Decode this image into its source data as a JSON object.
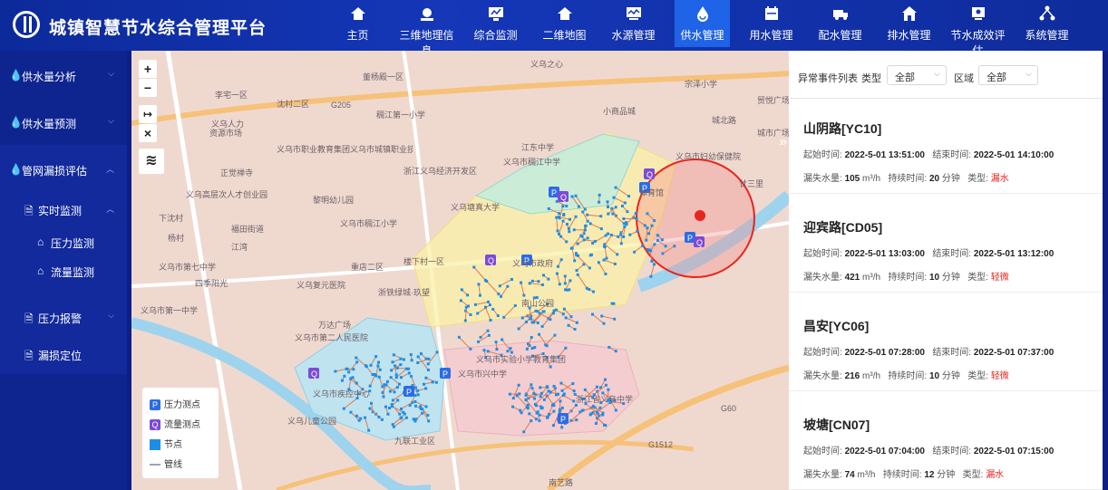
{
  "app": {
    "title": "城镇智慧节水综合管理平台"
  },
  "nav": [
    {
      "label": "主页",
      "icon": "home-icon"
    },
    {
      "label": "三维地理信息",
      "icon": "globe-icon"
    },
    {
      "label": "综合监测",
      "icon": "monitor-icon"
    },
    {
      "label": "二维地图",
      "icon": "home-icon"
    },
    {
      "label": "水源管理",
      "icon": "screen-chart-icon"
    },
    {
      "label": "供水管理",
      "icon": "water-drop-icon",
      "active": true
    },
    {
      "label": "用水管理",
      "icon": "calendar-icon"
    },
    {
      "label": "配水管理",
      "icon": "truck-icon"
    },
    {
      "label": "排水管理",
      "icon": "house-icon"
    },
    {
      "label": "节水成效评估",
      "icon": "display-icon"
    },
    {
      "label": "系统管理",
      "icon": "network-icon"
    }
  ],
  "sidebar": {
    "items": [
      {
        "label": "供水量分析",
        "level": 1
      },
      {
        "label": "供水量预测",
        "level": 1
      },
      {
        "label": "管网漏损评估",
        "level": 1,
        "open": true
      },
      {
        "label": "实时监测",
        "level": 2,
        "open": true
      },
      {
        "label": "压力监测",
        "level": 3
      },
      {
        "label": "流量监测",
        "level": 3
      },
      {
        "label": "压力报警",
        "level": 2
      },
      {
        "label": "漏损定位",
        "level": 2
      }
    ]
  },
  "panel": {
    "list_title": "异常事件列表",
    "type_label": "类型",
    "type_value": "全部",
    "area_label": "区域",
    "area_value": "全部",
    "labels": {
      "start": "起始时间:",
      "end": "结束时间:",
      "loss": "漏失水量:",
      "duration": "持续时间:",
      "type": "类型:"
    },
    "events": [
      {
        "name": "山阴路[YC10]",
        "start": "2022-5-01 13:51:00",
        "end": "2022-5-01 14:10:00",
        "loss": "105",
        "unit": "m³/h",
        "duration": "20",
        "dur_unit": "分钟",
        "type": "漏水"
      },
      {
        "name": "迎宾路[CD05]",
        "start": "2022-5-01 13:03:00",
        "end": "2022-5-01 13:12:00",
        "loss": "421",
        "unit": "m³/h",
        "duration": "10",
        "dur_unit": "分钟",
        "type": "轻微"
      },
      {
        "name": "昌安[YC06]",
        "start": "2022-5-01 07:28:00",
        "end": "2022-5-01 07:37:00",
        "loss": "216",
        "unit": "m³/h",
        "duration": "10",
        "dur_unit": "分钟",
        "type": "轻微"
      },
      {
        "name": "坡塘[CN07]",
        "start": "2022-5-01 07:04:00",
        "end": "2022-5-01 07:15:00",
        "loss": "74",
        "unit": "m³/h",
        "duration": "12",
        "dur_unit": "分钟",
        "type": "漏水"
      }
    ]
  },
  "map": {
    "controls": {
      "zoom_in": "+",
      "zoom_out": "−",
      "measure": "↦",
      "close": "×"
    },
    "legend": [
      {
        "label": "压力测点",
        "symbol": "P"
      },
      {
        "label": "流量测点",
        "symbol": "Q"
      },
      {
        "label": "节点",
        "symbol": ""
      },
      {
        "label": "管线",
        "symbol": ""
      }
    ],
    "labels": [
      "义乌之心",
      "董杨殿一区",
      "李宅一区",
      "沈村二区",
      "义乌人力",
      "资源市场",
      "稠江第一小学",
      "义乌市职业教育集团义乌市城镇职业技术学校",
      "正觉禅寺",
      "义乌高层次人才创业园",
      "浙江义乌经济开发区",
      "义乌市稠江中学",
      "黎明幼儿园",
      "义乌市稠江小学",
      "重店二区",
      "义乌塘真大学",
      "楼下村一区",
      "浙铁绿城·玖望",
      "义乌复元医院",
      "万达广场",
      "南山公园",
      "义乌市政府",
      "义乌市第二人民医院",
      "义乌市兴中学",
      "义乌儿童公园",
      "九联工业区",
      "浙江省义乌中学",
      "义乌市实验小学教育集团",
      "义乌市疾控中心",
      "城市广场",
      "贸悦广场",
      "宗泽小学",
      "义乌市妇幼保健院",
      "小商品城",
      "体育馆",
      "南艺路",
      "义乌市第一中学",
      "义乌市第七中学",
      "城北路",
      "江东中学",
      "福田街道",
      "下沈村",
      "廿三里",
      "杨村",
      "江湾",
      "四季阳光",
      "G1512",
      "G60",
      "G205"
    ]
  },
  "colors": {
    "brand": "#0c2a9a",
    "active_nav": "#1f63e6",
    "alarm": "#e8251c",
    "node": "#1d8ee6"
  }
}
